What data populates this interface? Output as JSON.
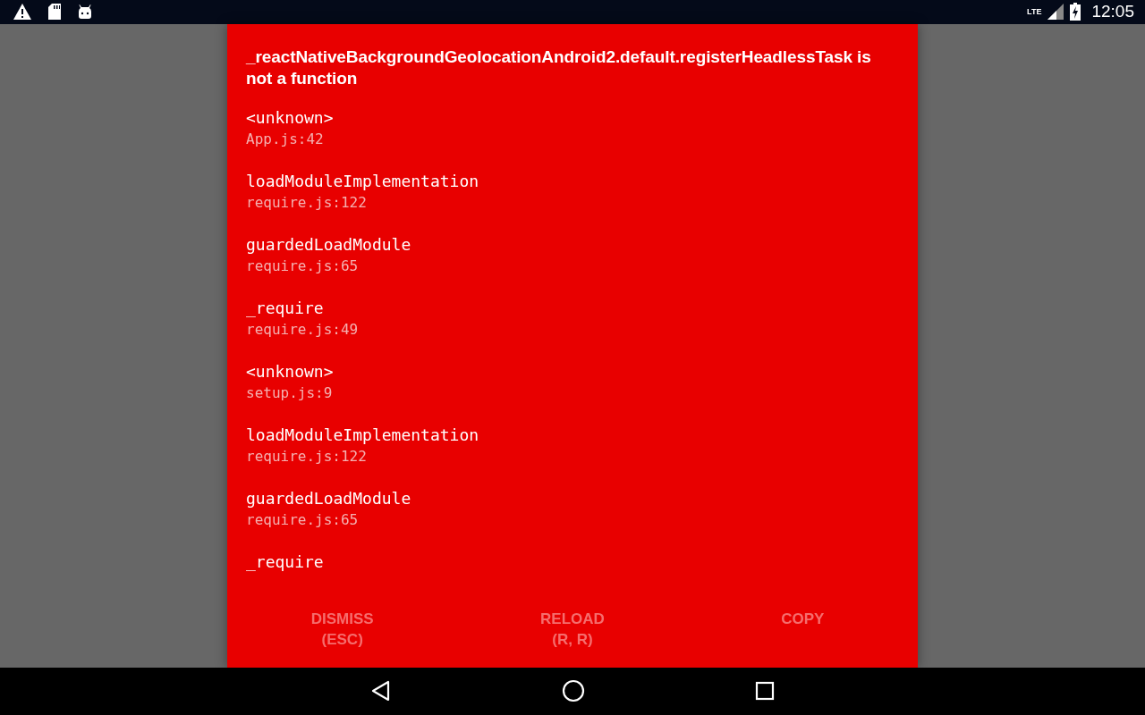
{
  "status_bar": {
    "time": "12:05",
    "network": "LTE"
  },
  "error": {
    "message": "_reactNativeBackgroundGeolocationAndroid2.default.registerHeadlessTask is not a function",
    "stack": [
      {
        "method": "<unknown>",
        "location": "App.js:42"
      },
      {
        "method": "loadModuleImplementation",
        "location": "require.js:122"
      },
      {
        "method": "guardedLoadModule",
        "location": "require.js:65"
      },
      {
        "method": "_require",
        "location": "require.js:49"
      },
      {
        "method": "<unknown>",
        "location": "setup.js:9"
      },
      {
        "method": "loadModuleImplementation",
        "location": "require.js:122"
      },
      {
        "method": "guardedLoadModule",
        "location": "require.js:65"
      },
      {
        "method": "_require"
      }
    ]
  },
  "buttons": [
    {
      "label": "DISMISS\n(ESC)"
    },
    {
      "label": "RELOAD\n(R, R)"
    },
    {
      "label": "COPY"
    }
  ]
}
